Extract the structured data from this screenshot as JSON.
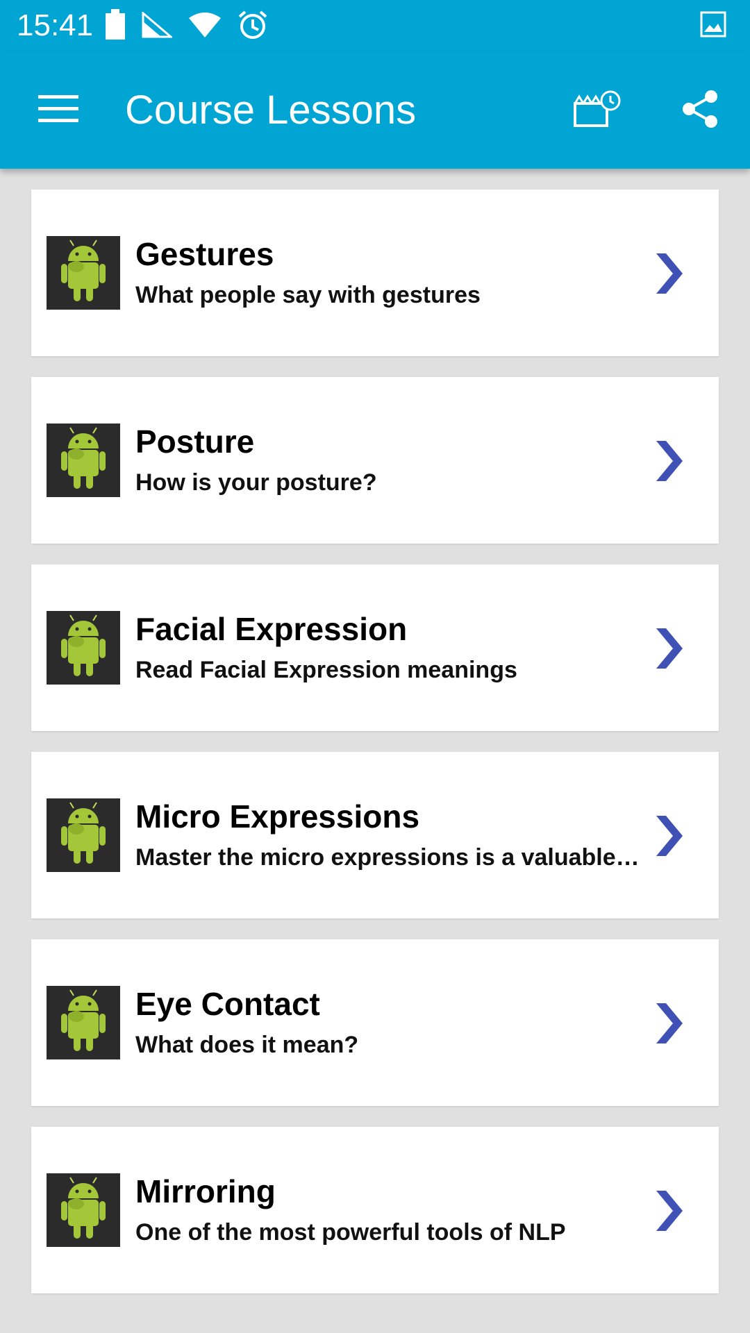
{
  "status_bar": {
    "time": "15:41",
    "icons": [
      "battery-icon",
      "signal-icon",
      "wifi-icon",
      "alarm-icon",
      "image-notification-icon"
    ]
  },
  "app_bar": {
    "title": "Course Lessons",
    "actions": [
      "menu-icon",
      "reminder-icon",
      "share-icon"
    ]
  },
  "colors": {
    "app_bar": "#01a5d3",
    "background": "#e0e0e0",
    "card": "#ffffff",
    "chevron": "#3f51b5",
    "android_green": "#a4c639",
    "thumb_bg": "#2b2b2b"
  },
  "lessons": [
    {
      "title": "Gestures",
      "subtitle": "What people say with gestures",
      "icon": "android-icon"
    },
    {
      "title": "Posture",
      "subtitle": "How is your posture?",
      "icon": "android-icon"
    },
    {
      "title": "Facial Expression",
      "subtitle": "Read Facial Expression meanings",
      "icon": "android-icon"
    },
    {
      "title": "Micro Expressions",
      "subtitle": "Master the micro expressions is a valuable skill",
      "icon": "android-icon"
    },
    {
      "title": "Eye Contact",
      "subtitle": "What does it mean?",
      "icon": "android-icon"
    },
    {
      "title": "Mirroring",
      "subtitle": "One of the most powerful tools of NLP",
      "icon": "android-icon"
    }
  ]
}
